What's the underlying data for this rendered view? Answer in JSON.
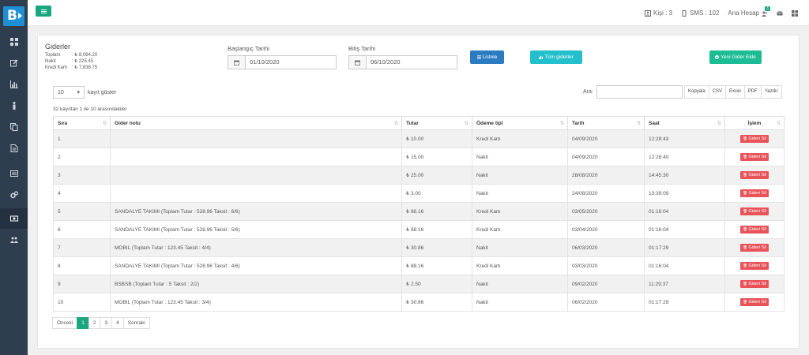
{
  "brand": {
    "logo_letter": "B"
  },
  "topbar": {
    "kisi": "Kişi : 3",
    "sms": "SMS : 102",
    "account": "Ana Hesap",
    "notification_count": "3"
  },
  "summary": {
    "title": "Giderler",
    "rows": [
      {
        "label": "Toplam",
        "value": ": ₺ 8,064.20"
      },
      {
        "label": "Nakit",
        "value": ": ₺ 225.45"
      },
      {
        "label": "Kredi Kartı",
        "value": ": ₺ 7,838.75"
      }
    ]
  },
  "filters": {
    "start_label": "Başlangıç Tarihi",
    "start_value": "01/10/2020",
    "end_label": "Bitiş Tarihi",
    "end_value": "06/10/2020",
    "list_button": "Listele",
    "all_button": "Tüm giderler",
    "add_button": "Yeni Gider Ekle"
  },
  "table_controls": {
    "page_length": "10",
    "page_length_suffix": "kayıt göster",
    "info": "32 kayıttan 1 ile 10 arasındakiler",
    "search_label": "Ara:",
    "exports": [
      "Kopyala",
      "CSV",
      "Excel",
      "PDF",
      "Yazdır"
    ]
  },
  "table": {
    "headers": [
      "Sıra",
      "Gider notu",
      "Tutar",
      "Ödeme tipi",
      "Tarih",
      "Saat",
      "İşlem"
    ],
    "delete_label": "Gideri Sil",
    "rows": [
      [
        "1",
        "",
        "₺ 10.00",
        "Kredi Kartı",
        "04/09/2020",
        "12:28:43"
      ],
      [
        "2",
        "",
        "₺ 15.00",
        "Nakit",
        "04/09/2020",
        "12:28:40"
      ],
      [
        "3",
        "",
        "₺ 25.00",
        "Nakit",
        "28/08/2020",
        "14:45:30"
      ],
      [
        "4",
        "",
        "₺ 3.00",
        "Nakit",
        "24/08/2020",
        "13:39:09"
      ],
      [
        "5",
        "SANDALYE TAKIMI (Toplam Tutar : 528.96 Taksit : 6/6)",
        "₺ 88.16",
        "Kredi Kartı",
        "03/05/2020",
        "01:16:04"
      ],
      [
        "6",
        "SANDALYE TAKIMI (Toplam Tutar : 528.96 Taksit : 5/6)",
        "₺ 88.16",
        "Kredi Kartı",
        "03/04/2020",
        "01:16:04"
      ],
      [
        "7",
        "MOBIL (Toplam Tutar : 123.45 Taksit : 4/4)",
        "₺ 30.86",
        "Nakit",
        "06/03/2020",
        "01:17:29"
      ],
      [
        "8",
        "SANDALYE TAKIMI (Toplam Tutar : 528.96 Taksit : 4/6)",
        "₺ 88.16",
        "Kredi Kartı",
        "03/03/2020",
        "01:16:04"
      ],
      [
        "9",
        "BSBSB (Toplam Tutar : 5 Taksit : 2/2)",
        "₺ 2.50",
        "Nakit",
        "09/02/2020",
        "11:29:37"
      ],
      [
        "10",
        "MOBIL (Toplam Tutar : 123.45 Taksit : 3/4)",
        "₺ 30.86",
        "Nakit",
        "06/02/2020",
        "01:17:29"
      ]
    ]
  },
  "pagination": {
    "prev": "Önceki",
    "pages": [
      "1",
      "2",
      "3",
      "4"
    ],
    "active_page": "1",
    "next": "Sonraki"
  },
  "colors": {
    "sidebar": "#2f3e4f",
    "primary_green": "#1aa77f",
    "blue": "#2b7bc2",
    "teal": "#24bfcc",
    "danger": "#e8535a"
  },
  "sidebar_icons": [
    "dashboard-icon",
    "edit-icon",
    "chart-icon",
    "person-icon",
    "copy-icon",
    "document-icon",
    "card-icon",
    "cogs-icon",
    "money-icon",
    "users-icon"
  ]
}
